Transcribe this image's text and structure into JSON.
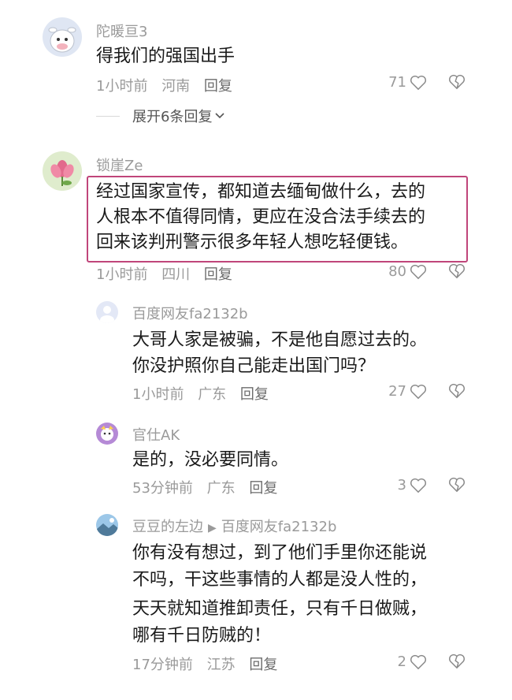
{
  "comments": [
    {
      "user": "陀暖亘3",
      "text": "得我们的强国出手",
      "time": "1小时前",
      "location": "河南",
      "reply_label": "回复",
      "likes": "71",
      "expand_label": "展开6条回复"
    },
    {
      "user": "锁崖Ze",
      "text_lines": [
        "经过国家宣传，都知道去缅甸做什么，去的",
        "人根本不值得同情，更应在没合法手续去的",
        "回来该判刑警示很多年轻人想吃轻便钱。"
      ],
      "time": "1小时前",
      "location": "四川",
      "reply_label": "回复",
      "likes": "80",
      "replies": [
        {
          "user": "百度网友fa2132b",
          "text_lines": [
            "大哥人家是被骗，不是他自愿过去的。",
            "你没护照你自己能走出国门吗？"
          ],
          "time": "1小时前",
          "location": "广东",
          "reply_label": "回复",
          "likes": "27"
        },
        {
          "user": "官仕AK",
          "text_lines": [
            "是的，没必要同情。"
          ],
          "time": "53分钟前",
          "location": "广东",
          "reply_label": "回复",
          "likes": "3"
        },
        {
          "user": "豆豆的左边",
          "reply_to": "百度网友fa2132b",
          "text_lines": [
            "你有没有想过，到了他们手里你还能说",
            "不吗，干这些事情的人都是没人性的，",
            "天天就知道推卸责任，只有千日做贼，",
            "哪有千日防贼的！"
          ],
          "time": "17分钟前",
          "location": "江苏",
          "reply_label": "回复",
          "likes": "2"
        }
      ]
    }
  ],
  "colors": {
    "highlight_border": "#c0457a",
    "meta": "#9a9a9a",
    "text": "#1a1a1a"
  },
  "icons": [
    "like-heart-icon",
    "dislike-broken-heart-icon",
    "chevron-down-icon"
  ]
}
